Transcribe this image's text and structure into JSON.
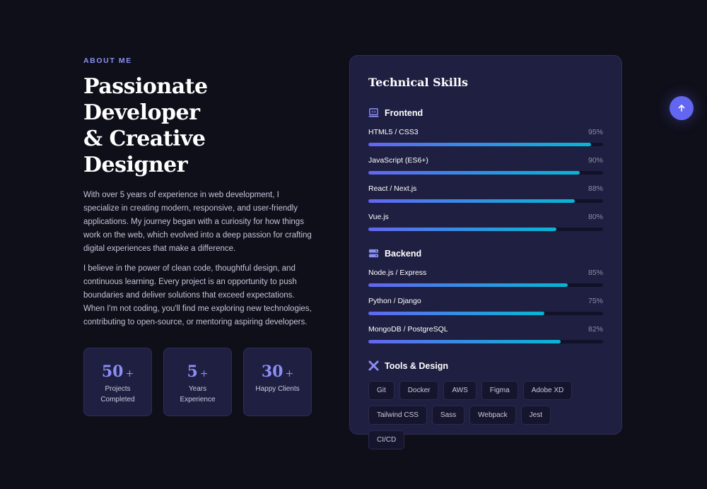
{
  "about": {
    "eyebrow": "ABOUT ME",
    "title_line1": "Passionate Developer",
    "title_line2": "& Creative Designer",
    "paragraph1": "With over 5 years of experience in web development, I specialize in creating modern, responsive, and user-friendly applications. My journey began with a curiosity for how things work on the web, which evolved into a deep passion for crafting digital experiences that make a difference.",
    "paragraph2": "I believe in the power of clean code, thoughtful design, and continuous learning. Every project is an opportunity to push boundaries and deliver solutions that exceed expectations. When I'm not coding, you'll find me exploring new technologies, contributing to open-source, or mentoring aspiring developers.",
    "stats": [
      {
        "number": "50",
        "suffix": "+",
        "label": "Projects Completed"
      },
      {
        "number": "5",
        "suffix": "+",
        "label": "Years Experience"
      },
      {
        "number": "30",
        "suffix": "+",
        "label": "Happy Clients"
      }
    ]
  },
  "skills": {
    "title": "Technical Skills",
    "frontend": {
      "label": "Frontend",
      "items": [
        {
          "name": "HTML5 / CSS3",
          "pct": "95%",
          "value": 95
        },
        {
          "name": "JavaScript (ES6+)",
          "pct": "90%",
          "value": 90
        },
        {
          "name": "React / Next.js",
          "pct": "88%",
          "value": 88
        },
        {
          "name": "Vue.js",
          "pct": "80%",
          "value": 80
        }
      ]
    },
    "backend": {
      "label": "Backend",
      "items": [
        {
          "name": "Node.js / Express",
          "pct": "85%",
          "value": 85
        },
        {
          "name": "Python / Django",
          "pct": "75%",
          "value": 75
        },
        {
          "name": "MongoDB / PostgreSQL",
          "pct": "82%",
          "value": 82
        }
      ]
    },
    "tools": {
      "label": "Tools & Design",
      "tags": [
        "Git",
        "Docker",
        "AWS",
        "Figma",
        "Adobe XD",
        "Tailwind CSS",
        "Sass",
        "Webpack",
        "Jest",
        "CI/CD"
      ]
    }
  },
  "colors": {
    "accent": "#6366f1",
    "accent2": "#06b6d4",
    "bg": "#0f0f1a",
    "card": "#1f1f42"
  }
}
